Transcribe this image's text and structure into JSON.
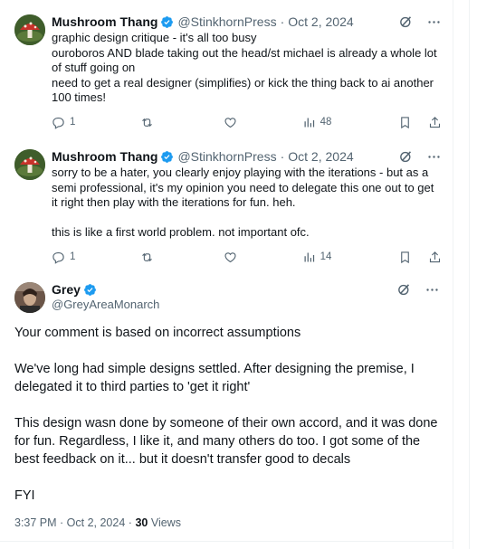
{
  "colors": {
    "accent": "#1d9bf0",
    "muted": "#536471",
    "text": "#0f1419"
  },
  "replies": [
    {
      "name": "Mushroom Thang",
      "handle": "@StinkhornPress",
      "date": "Oct 2, 2024",
      "text": "graphic design critique - it's all too busy\nouroboros AND blade taking out the head/st michael is already a whole lot of stuff going on\nneed to get a real designer (simplifies) or kick the thing back to ai another 100 times!",
      "reply_count": "1",
      "views": "48"
    },
    {
      "name": "Mushroom Thang",
      "handle": "@StinkhornPress",
      "date": "Oct 2, 2024",
      "text": "sorry to be a hater, you clearly enjoy playing with the iterations - but as a semi professional, it's my opinion you need to delegate this one out to get it right then play with the iterations for fun. heh.\n\nthis is like a first world problem. not important ofc.",
      "reply_count": "1",
      "views": "14"
    }
  ],
  "main": {
    "name": "Grey",
    "handle": "@GreyAreaMonarch",
    "paragraphs": [
      "Your comment is based on incorrect assumptions",
      "We've long had simple designs settled. After designing the premise, I delegated it to third parties to 'get it right'",
      "This design wasn done by someone of their own accord, and it was done for fun. Regardless, I like it, and many others do too. I got some of the best feedback on it... but it doesn't transfer good to decals",
      "FYI"
    ],
    "time": "3:37 PM · Oct 2, 2024",
    "views_count": "30",
    "views_label": "Views"
  },
  "separator": "·"
}
